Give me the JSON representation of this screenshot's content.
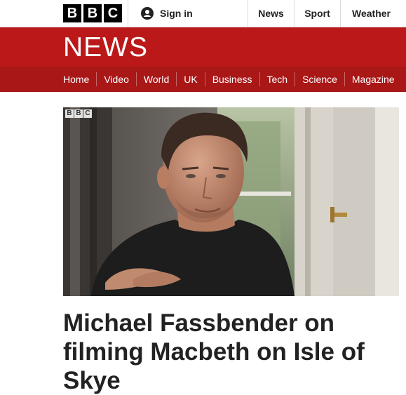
{
  "brand": {
    "logo_letters": [
      "B",
      "B",
      "C"
    ],
    "accent_red": "#bb1919",
    "nav_red": "#a91717"
  },
  "topbar": {
    "signin_label": "Sign in",
    "signin_icon": "user-icon",
    "links": [
      "News",
      "Sport",
      "Weather"
    ]
  },
  "masthead": {
    "title": "NEWS"
  },
  "nav": {
    "items": [
      "Home",
      "Video",
      "World",
      "UK",
      "Business",
      "Tech",
      "Science",
      "Magazine"
    ]
  },
  "media": {
    "bug_letters": [
      "B",
      "B",
      "C"
    ],
    "subject": "video-still"
  },
  "article": {
    "headline": "Michael Fassbender on filming Macbeth on Isle of Skye"
  }
}
